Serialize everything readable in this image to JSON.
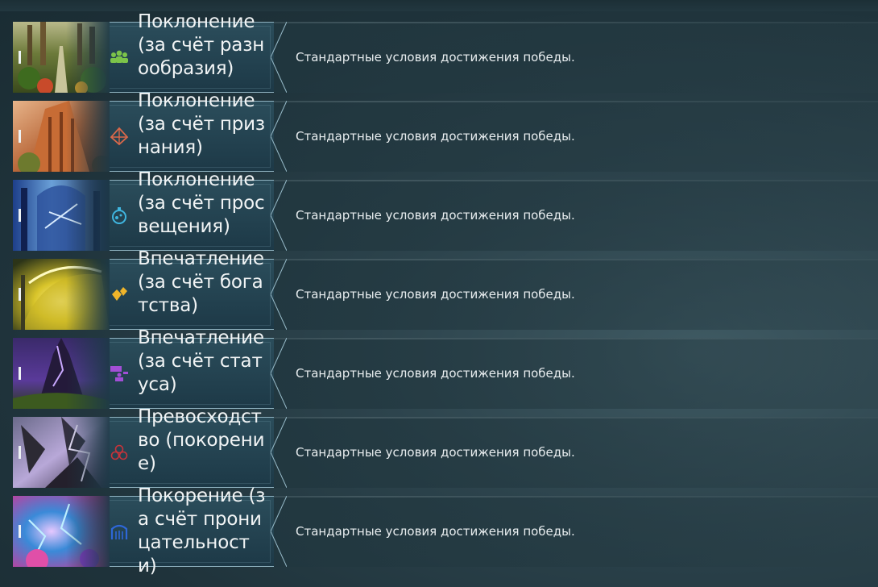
{
  "rows": [
    {
      "title": "Поклонение (за счёт разнообразия)",
      "description": "Стандартные условия достижения победы.",
      "icon": "people-group-icon",
      "icon_color": "#7cc44a"
    },
    {
      "title": "Поклонение (за счёт признания)",
      "description": "Стандартные условия достижения победы.",
      "icon": "pyramid-icon",
      "icon_color": "#d9684a"
    },
    {
      "title": "Поклонение (за счёт просвещения)",
      "description": "Стандартные условия достижения победы.",
      "icon": "flask-icon",
      "icon_color": "#3fb6e0"
    },
    {
      "title": "Впечатление (за счёт богатства)",
      "description": "Стандартные условия достижения победы.",
      "icon": "gems-icon",
      "icon_color": "#f0b52a"
    },
    {
      "title": "Впечатление (за счёт статуса)",
      "description": "Стандартные условия достижения победы.",
      "icon": "podium-icon",
      "icon_color": "#a24fd6"
    },
    {
      "title": "Превосходство (покорение)",
      "description": "Стандартные условия достижения победы.",
      "icon": "circles-icon",
      "icon_color": "#c8333a"
    },
    {
      "title": "Покорение (за счёт проницательности)",
      "description": "Стандартные условия достижения победы.",
      "icon": "gate-icon",
      "icon_color": "#2e67d8"
    }
  ]
}
